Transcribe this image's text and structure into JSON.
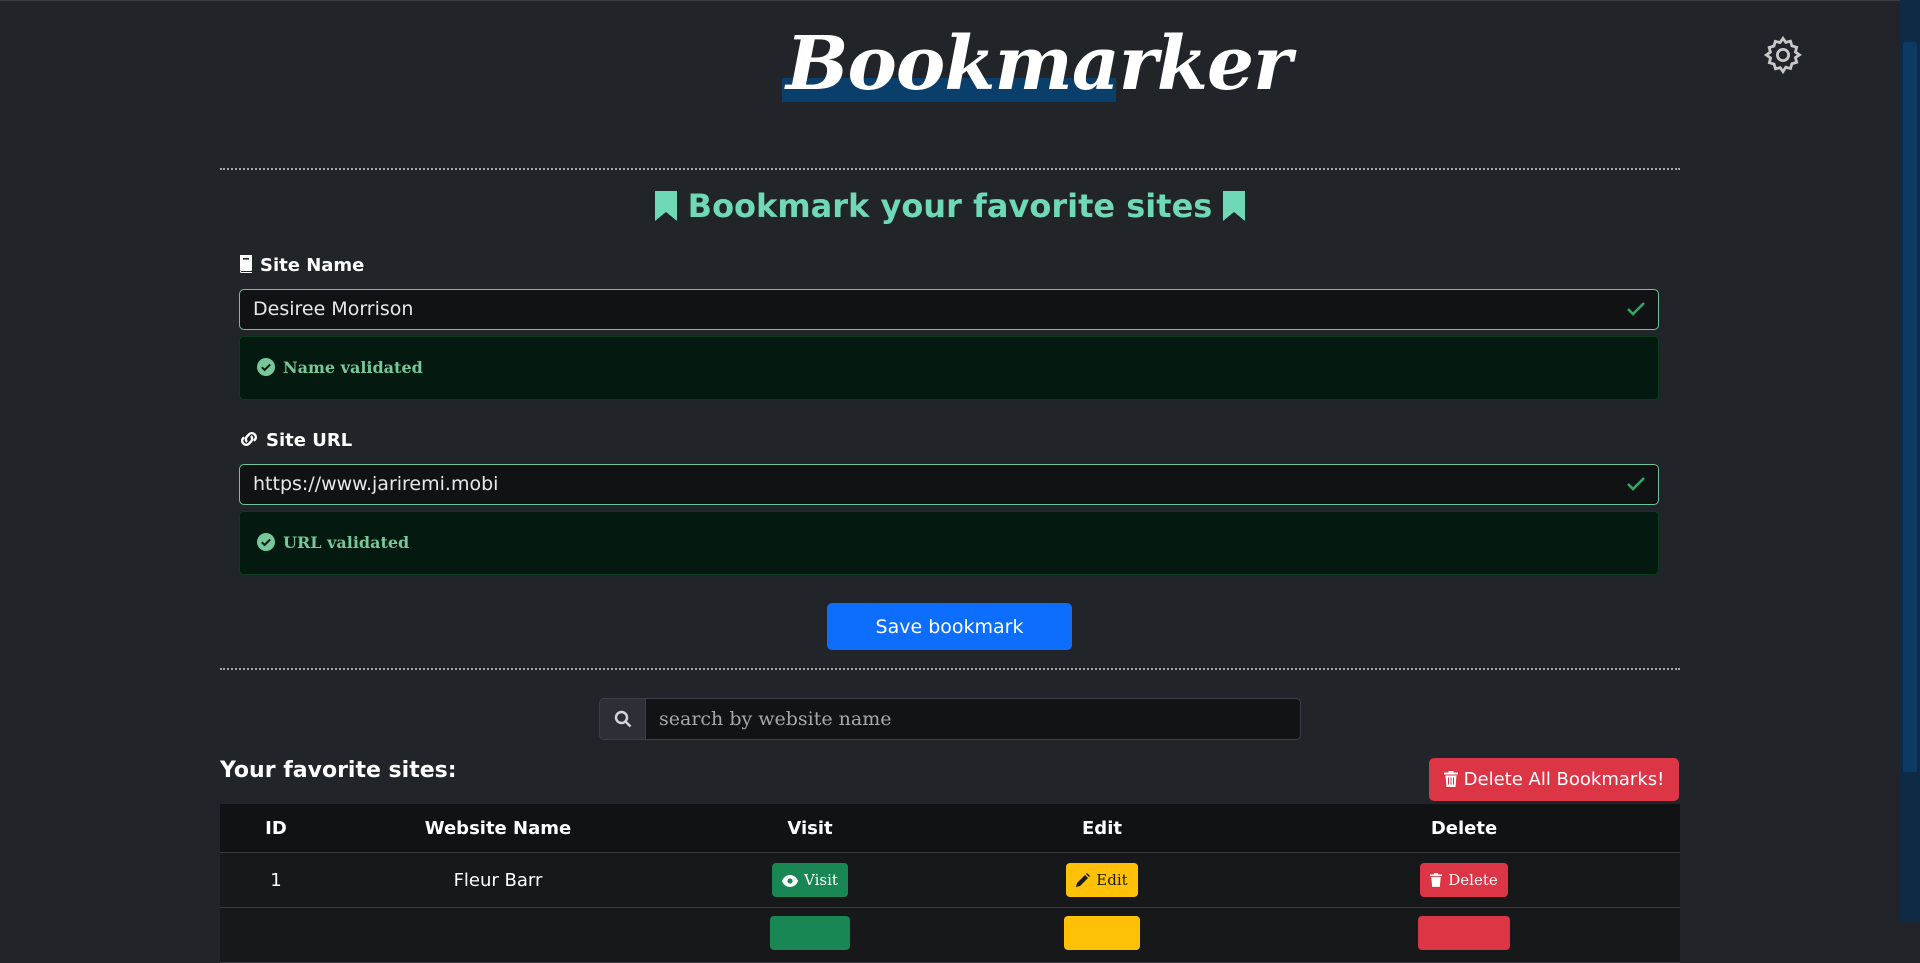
{
  "app": {
    "logo_text": "Bookmarker"
  },
  "form": {
    "heading": "Bookmark your favorite sites",
    "site_name": {
      "label": "Site Name",
      "value": "Desiree Morrison",
      "validation": "Name validated"
    },
    "site_url": {
      "label": "Site URL",
      "value": "https://www.jariremi.mobi",
      "validation": "URL validated"
    },
    "save_label": "Save bookmark"
  },
  "search": {
    "placeholder": "search by website name"
  },
  "list": {
    "title": "Your favorite sites:",
    "delete_all_label": "Delete All Bookmarks!",
    "columns": [
      "ID",
      "Website Name",
      "Visit",
      "Edit",
      "Delete"
    ],
    "rows": [
      {
        "id": "1",
        "name": "Fleur Barr",
        "visit": "Visit",
        "edit": "Edit",
        "delete": "Delete"
      }
    ]
  },
  "colors": {
    "background": "#212429",
    "accent_teal": "#6fd8b6",
    "primary": "#0d6efd",
    "danger": "#dc3545",
    "success": "#198754",
    "warning": "#ffc107"
  },
  "icons": {
    "settings": "gear-icon",
    "heading": "bookmark-icon",
    "name": "book-icon",
    "url": "link-icon",
    "valid": "check-circle-icon",
    "search": "search-icon",
    "trash": "trash-icon",
    "visit": "eye-icon",
    "edit": "pencil-icon"
  }
}
